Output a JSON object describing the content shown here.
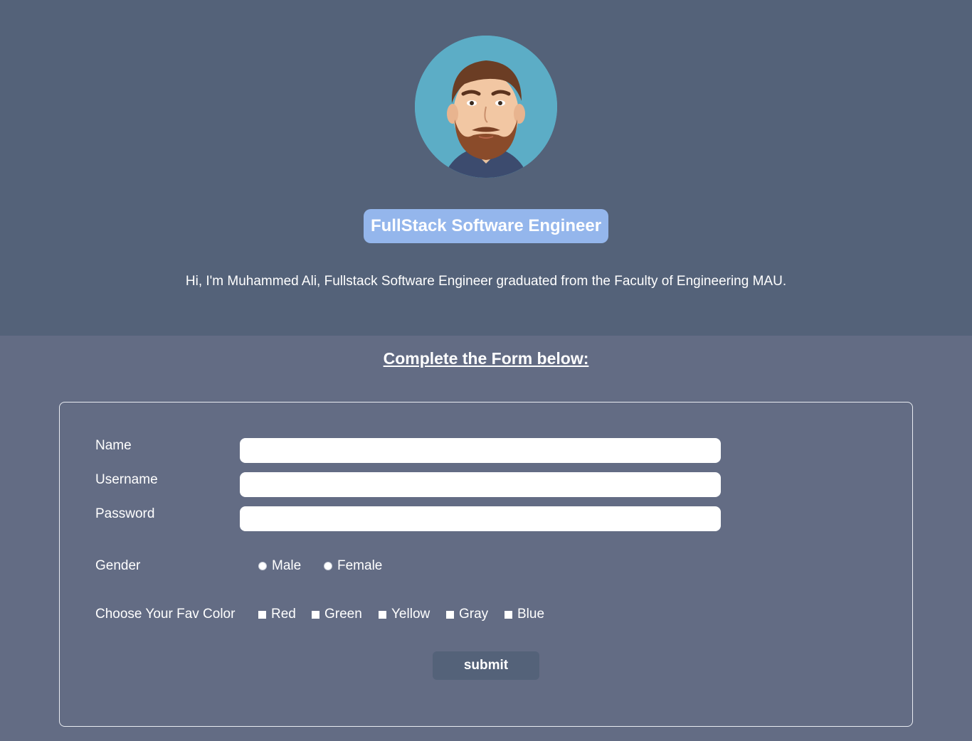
{
  "profile": {
    "avatar_alt": "avatar",
    "role": "FullStack Software Engineer",
    "intro": "Hi, I'm Muhammed Ali, Fullstack Software Engineer graduated from the Faculty of Engineering MAU."
  },
  "form": {
    "heading": "Complete the Form below:",
    "name_label": "Name",
    "name_value": "",
    "username_label": "Username",
    "username_value": "",
    "password_label": "Password",
    "password_value": "",
    "gender_label": "Gender",
    "gender_options": [
      "Male",
      "Female"
    ],
    "color_label": "Choose Your Fav Color",
    "color_options": [
      "Red",
      "Green",
      "Yellow",
      "Gray",
      "Blue"
    ],
    "submit_label": "submit"
  },
  "colors": {
    "hero_bg": "#546279",
    "page_bg": "#636c84",
    "badge_bg": "#94b6ec"
  }
}
